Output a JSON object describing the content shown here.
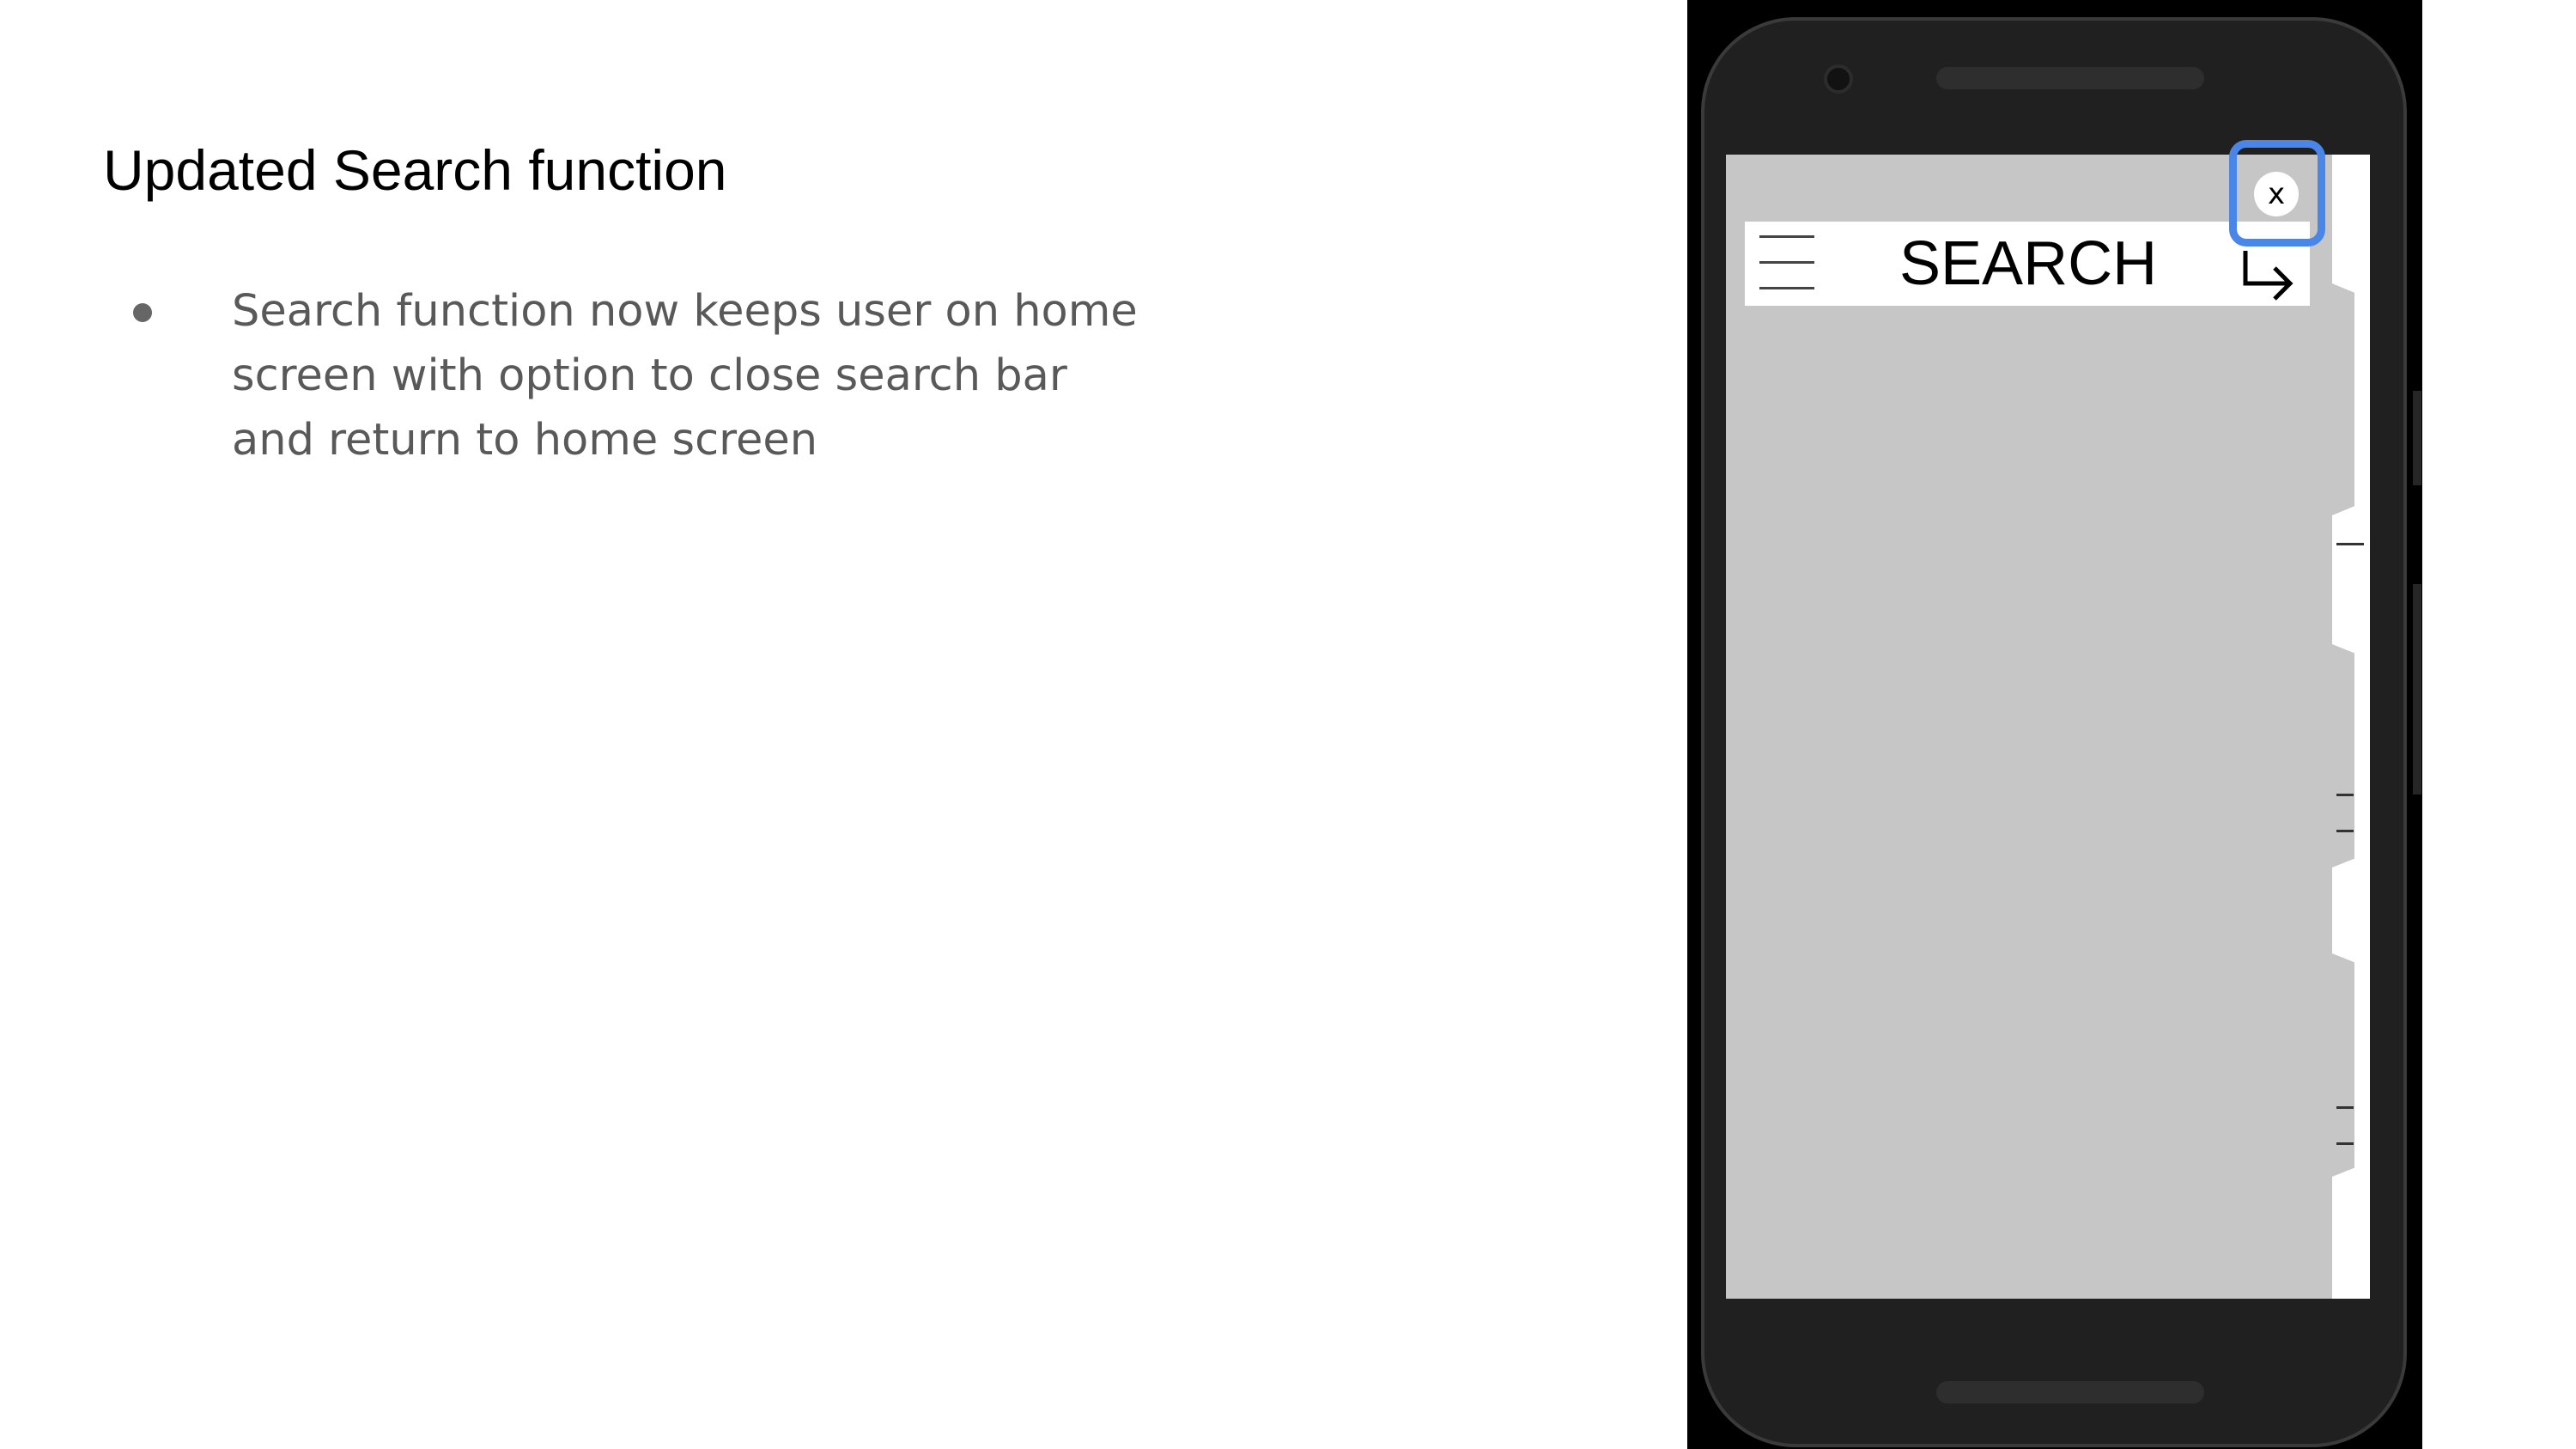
{
  "slide": {
    "title": "Updated Search function",
    "bullets": [
      "Search function now keeps user on home screen with option to close search bar and return to home screen"
    ]
  },
  "phone": {
    "search_bar": {
      "menu_icon": "hamburger-icon",
      "label": "SEARCH",
      "go_icon": "return-arrow-icon"
    },
    "close_button": {
      "label": "x",
      "highlight_color": "#4a86e8"
    }
  }
}
